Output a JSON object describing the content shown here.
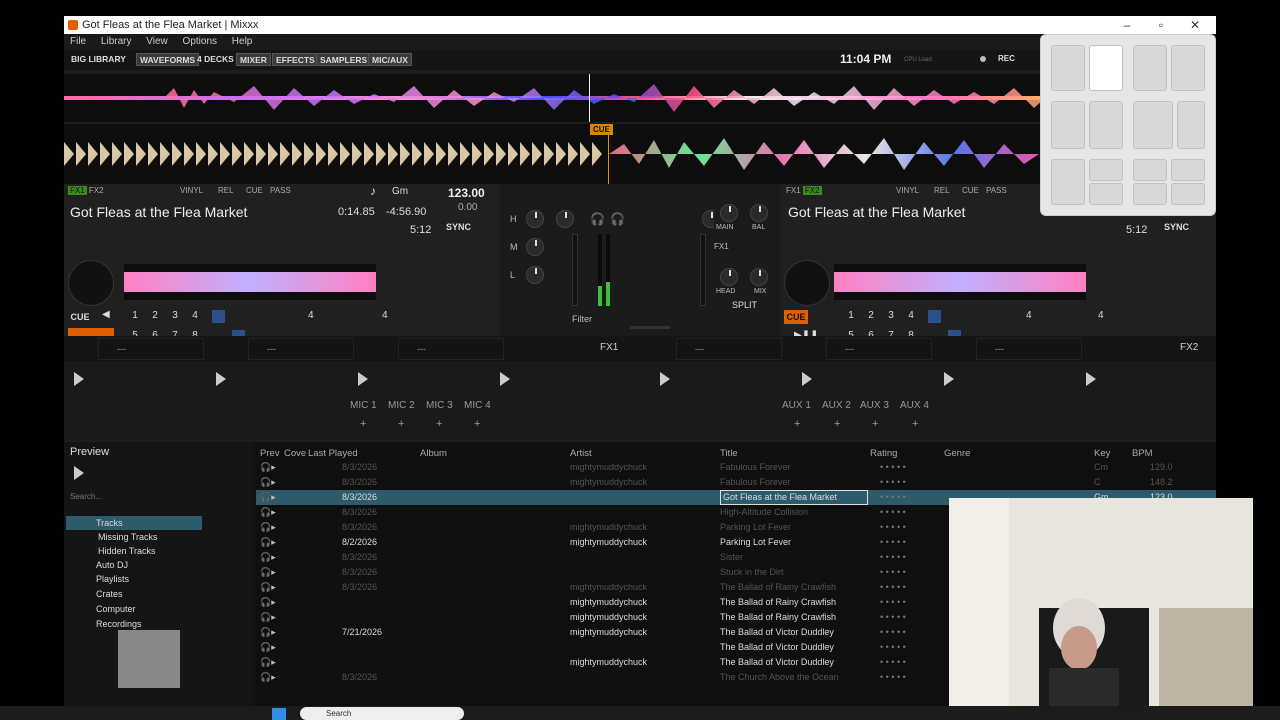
{
  "window": {
    "title": "Got Fleas at the Flea Market | Mixxx"
  },
  "menu": [
    "File",
    "Library",
    "View",
    "Options",
    "Help"
  ],
  "toolbar": {
    "big_library": "BIG LIBRARY",
    "waveforms": "WAVEFORMS",
    "four_decks": "4 DECKS",
    "mixer": "MIXER",
    "effects": "EFFECTS",
    "samplers": "SAMPLERS",
    "mic_aux": "MIC/AUX",
    "clock": "11:04 PM",
    "cpu": "CPU Load",
    "rec": "REC"
  },
  "waveform": {
    "cue_label": "CUE"
  },
  "deck1": {
    "fx1": "FX1",
    "fx2": "FX2",
    "vinyl": "VINYL",
    "rel": "REL",
    "cue": "CUE",
    "pass": "PASS",
    "key": "Gm",
    "bpm": "123.00",
    "bpm_offset": "0.00",
    "title": "Got Fleas at the Flea Market",
    "elapsed": "0:14.85",
    "remaining": "-4:56.90",
    "duration": "5:12",
    "sync": "SYNC",
    "cue_btn": "CUE",
    "hotcues": [
      "1",
      "2",
      "3",
      "4",
      "5",
      "6",
      "7",
      "8"
    ],
    "loop_size": "4",
    "beatjump": "4"
  },
  "deck2": {
    "fx1": "FX1",
    "fx2": "FX2",
    "vinyl": "VINYL",
    "rel": "REL",
    "cue": "CUE",
    "pass": "PASS",
    "title": "Got Fleas at the Flea Market",
    "duration": "5:12",
    "sync": "SYNC",
    "cue_btn": "CUE",
    "hotcues": [
      "1",
      "2",
      "3",
      "4",
      "5",
      "6",
      "7",
      "8"
    ],
    "loop_size": "4",
    "beatjump": "4"
  },
  "mixer": {
    "eq_labels": [
      "H",
      "M",
      "L"
    ],
    "filter": "Filter",
    "main": "MAIN",
    "bal": "BAL",
    "head": "HEAD",
    "mix": "MIX",
    "split": "SPLIT",
    "fx_assign": [
      "FX1",
      "2",
      "3",
      "4"
    ]
  },
  "effects": {
    "unit1": "FX1",
    "unit2": "FX2",
    "slot_value": "---"
  },
  "mics": [
    "MIC 1",
    "MIC 2",
    "MIC 3",
    "MIC 4"
  ],
  "auxes": [
    "AUX 1",
    "AUX 2",
    "AUX 3",
    "AUX 4"
  ],
  "sidebar": {
    "preview": "Preview",
    "search_placeholder": "Search...",
    "tree": [
      "Tracks",
      "Missing Tracks",
      "Hidden Tracks",
      "Auto DJ",
      "Playlists",
      "Crates",
      "Computer",
      "Recordings"
    ]
  },
  "table": {
    "headers": [
      "Prev",
      "Cove",
      "Last Played",
      "Album",
      "Artist",
      "Title",
      "Rating",
      "Genre",
      "Key",
      "BPM"
    ],
    "rows": [
      {
        "last_played": "8/3/2026",
        "artist": "mightymuddychuck",
        "title": "Fabulous Forever",
        "key": "Cm",
        "bpm": "129.0",
        "style": "dim"
      },
      {
        "last_played": "8/3/2026",
        "artist": "mightymuddychuck",
        "title": "Fabulous Forever",
        "key": "C",
        "bpm": "148.2",
        "style": "dim"
      },
      {
        "last_played": "8/3/2026",
        "artist": "",
        "title": "Got Fleas at the Flea Market",
        "key": "Gm",
        "bpm": "123.0",
        "style": "selected"
      },
      {
        "last_played": "8/3/2026",
        "artist": "",
        "title": "High-Altitude Collision",
        "key": "",
        "bpm": "",
        "style": "dim"
      },
      {
        "last_played": "8/3/2026",
        "artist": "mightymuddychuck",
        "title": "Parking Lot Fever",
        "key": "",
        "bpm": "",
        "style": "dim"
      },
      {
        "last_played": "8/2/2026",
        "artist": "mightymuddychuck",
        "title": "Parking Lot Fever",
        "key": "",
        "bpm": "",
        "style": "bright"
      },
      {
        "last_played": "8/3/2026",
        "artist": "",
        "title": "Sister",
        "key": "",
        "bpm": "",
        "style": "dim"
      },
      {
        "last_played": "8/3/2026",
        "artist": "",
        "title": "Stuck in the Dirt",
        "key": "",
        "bpm": "",
        "style": "dim"
      },
      {
        "last_played": "8/3/2026",
        "artist": "mightymuddychuck",
        "title": "The Ballad of Rainy Crawfish",
        "key": "",
        "bpm": "",
        "style": "dim"
      },
      {
        "last_played": "",
        "artist": "mightymuddychuck",
        "title": "The Ballad of Rainy Crawfish",
        "key": "",
        "bpm": "",
        "style": "bright"
      },
      {
        "last_played": "",
        "artist": "mightymuddychuck",
        "title": "The Ballad of Rainy Crawfish",
        "key": "",
        "bpm": "",
        "style": "bright"
      },
      {
        "last_played": "7/21/2026",
        "artist": "mightymuddychuck",
        "title": "The Ballad of Victor Duddley",
        "key": "",
        "bpm": "",
        "style": "bright"
      },
      {
        "last_played": "",
        "artist": "",
        "title": "The Ballad of Victor Duddley",
        "key": "",
        "bpm": "",
        "style": "bright"
      },
      {
        "last_played": "",
        "artist": "mightymuddychuck",
        "title": "The Ballad of Victor Duddley",
        "key": "",
        "bpm": "",
        "style": "bright"
      },
      {
        "last_played": "8/3/2026",
        "artist": "",
        "title": "The Church Above the Ocean",
        "key": "",
        "bpm": "",
        "style": "dim"
      }
    ]
  },
  "taskbar": {
    "search": "Search"
  }
}
